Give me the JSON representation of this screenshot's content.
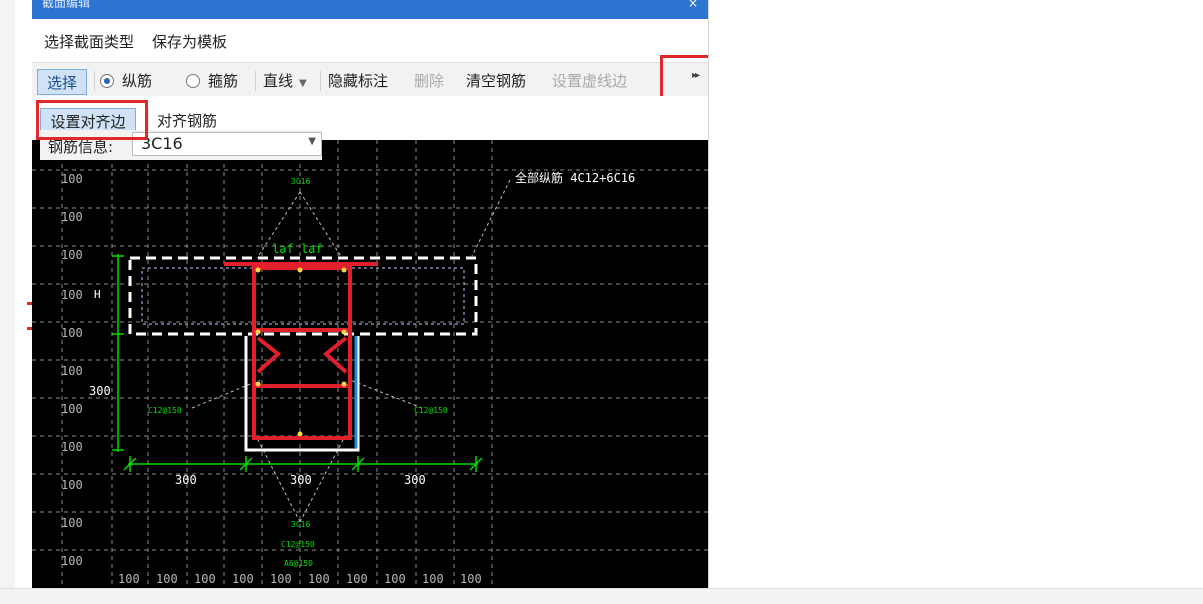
{
  "window": {
    "title": "截面编辑",
    "close_glyph": "×"
  },
  "menu": {
    "items": [
      "选择截面类型",
      "保存为模板"
    ]
  },
  "toolbar": {
    "select": "选择",
    "longitudinal": "纵筋",
    "stirrup": "箍筋",
    "line": "直线",
    "hide_annotation": "隐藏标注",
    "delete": "删除",
    "clear_rebar": "清空钢筋",
    "set_dashed_edge": "设置虚线边",
    "more_glyph": "▸▸"
  },
  "toolbar2": {
    "set_align_edge": "设置对齐边",
    "align_rebar": "对齐钢筋"
  },
  "rebar_info": {
    "label": "钢筋信息:",
    "value": "3C16"
  },
  "drawing": {
    "all_longitudinal": "全部纵筋 4C12+6C16",
    "top_rebar": "3C16",
    "bottom_rebar": "3C16",
    "left_stirrup": "C12@150",
    "right_stirrup": "C12@150",
    "bottom_stirrup": "C12@150",
    "bottom_tie": "A6@150",
    "laf_mark": "laf laf",
    "h_mark": "H",
    "dim_height": "300",
    "dim_left": "300",
    "dim_mid": "300",
    "dim_right": "300",
    "grid_label": "100"
  },
  "colors": {
    "titlebar": "#2d73d0",
    "highlight_box": "#e02828",
    "canvas_bg": "#000000",
    "rebar": "#e0202a",
    "dimension": "#00dd00",
    "stirrup_blue": "#1e8fe0"
  }
}
